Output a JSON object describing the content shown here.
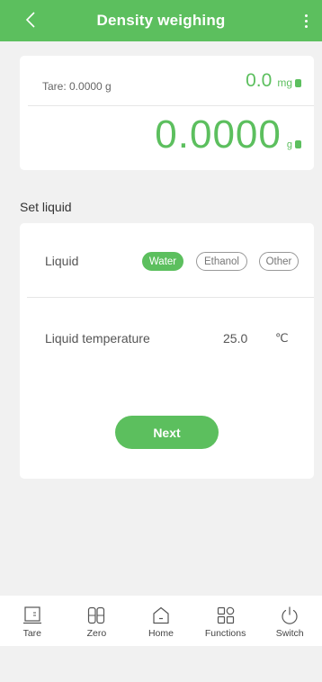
{
  "header": {
    "title": "Density weighing",
    "back_icon": "chevron-left-icon",
    "menu_icon": "more-vertical-icon",
    "color": "#5cbf5e"
  },
  "weight": {
    "tare_label": "Tare: 0.0000 g",
    "mg_value": "0.0",
    "mg_unit": "mg",
    "g_value": "0.0000",
    "g_unit": "g"
  },
  "set_liquid": {
    "section_label": "Set liquid",
    "liquid_label": "Liquid",
    "options": [
      "Water",
      "Ethanol",
      "Other"
    ],
    "selected": "Water",
    "temperature_label": "Liquid temperature",
    "temperature_value": "25.0",
    "temperature_unit": "℃",
    "next_label": "Next"
  },
  "bottom_nav": {
    "items": [
      {
        "label": "Tare",
        "icon": "tare-icon"
      },
      {
        "label": "Zero",
        "icon": "zero-icon"
      },
      {
        "label": "Home",
        "icon": "home-icon"
      },
      {
        "label": "Functions",
        "icon": "functions-icon"
      },
      {
        "label": "Switch",
        "icon": "power-icon"
      }
    ]
  },
  "colors": {
    "accent": "#5cbf5e",
    "background": "#f1f1f1"
  }
}
